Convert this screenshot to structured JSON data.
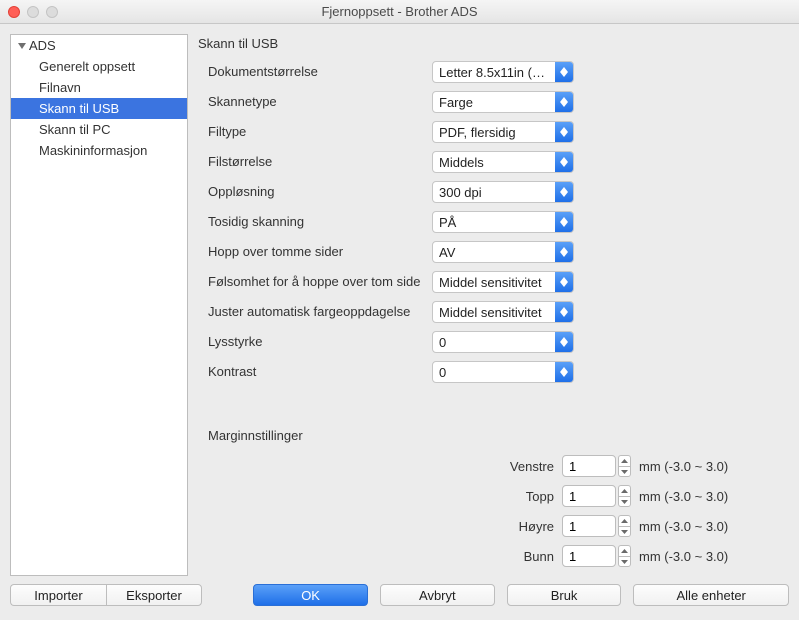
{
  "window": {
    "title": "Fjernoppsett - Brother ADS"
  },
  "sidebar": {
    "root": "ADS",
    "items": [
      {
        "label": "Generelt oppsett"
      },
      {
        "label": "Filnavn"
      },
      {
        "label": "Skann til USB"
      },
      {
        "label": "Skann til PC"
      },
      {
        "label": "Maskininformasjon"
      }
    ]
  },
  "section": {
    "title": "Skann til USB"
  },
  "form": {
    "docsize": {
      "label": "Dokumentstørrelse",
      "value": "Letter 8.5x11in (…"
    },
    "scantype": {
      "label": "Skannetype",
      "value": "Farge"
    },
    "filetype": {
      "label": "Filtype",
      "value": "PDF, flersidig"
    },
    "filesize": {
      "label": "Filstørrelse",
      "value": "Middels"
    },
    "res": {
      "label": "Oppløsning",
      "value": "300 dpi"
    },
    "duplex": {
      "label": "Tosidig skanning",
      "value": "PÅ"
    },
    "skipblank": {
      "label": "Hopp over tomme sider",
      "value": "AV"
    },
    "blanksens": {
      "label": "Følsomhet for å hoppe over tom side",
      "value": "Middel sensitivitet"
    },
    "autocolor": {
      "label": "Juster automatisk fargeoppdagelse",
      "value": "Middel sensitivitet"
    },
    "bright": {
      "label": "Lysstyrke",
      "value": "0"
    },
    "contrast": {
      "label": "Kontrast",
      "value": "0"
    }
  },
  "margins": {
    "title": "Marginnstillinger",
    "unit": "mm (-3.0 ~ 3.0)",
    "left": {
      "label": "Venstre",
      "value": "1"
    },
    "top": {
      "label": "Topp",
      "value": "1"
    },
    "right": {
      "label": "Høyre",
      "value": "1"
    },
    "bottom": {
      "label": "Bunn",
      "value": "1"
    }
  },
  "footer": {
    "import": "Importer",
    "export": "Eksporter",
    "ok": "OK",
    "cancel": "Avbryt",
    "apply": "Bruk",
    "alldev": "Alle enheter"
  }
}
